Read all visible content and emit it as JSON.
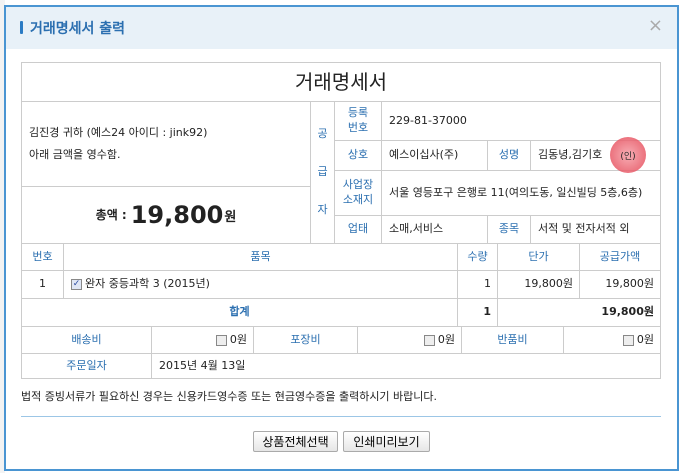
{
  "dialog": {
    "title": "거래명세서 출력",
    "close": "×"
  },
  "doc": {
    "title": "거래명세서",
    "customer": "김진경 귀하 (예스24 아이디 : jink92)",
    "receipt_note": "아래 금액을 영수함.",
    "total_label": "총액 : ",
    "total_value": "19,800",
    "total_unit": "원",
    "supplier_label": [
      "공",
      "급",
      "자"
    ],
    "reg_label": "등록\n번호",
    "reg_value": "229-81-37000",
    "company_label": "상호",
    "company_value": "예스이십사(주)",
    "name_label": "성명",
    "name_value": "김동녕,김기호",
    "seal": "(인)",
    "addr_label": "사업장\n소재지",
    "addr_value": "서울 영등포구 은행로 11(여의도동, 일신빌딩 5층,6층)",
    "biz_label": "업태",
    "biz_value": "소매,서비스",
    "item_label": "종목",
    "item_value": "서적 및 전자서적 외"
  },
  "items": {
    "headers": [
      "번호",
      "품목",
      "수량",
      "단가",
      "공급가액"
    ],
    "rows": [
      {
        "no": "1",
        "name": "완자 중등과학 3 (2015년)",
        "qty": "1",
        "price": "19,800원",
        "amount": "19,800원",
        "checked": true
      }
    ],
    "sum_label": "합계",
    "sum_qty": "1",
    "sum_amount": "19,800원"
  },
  "fees": [
    {
      "label": "배송비",
      "value": "0원"
    },
    {
      "label": "포장비",
      "value": "0원"
    },
    {
      "label": "반품비",
      "value": "0원"
    }
  ],
  "order": {
    "label": "주문일자",
    "value": "2015년 4월 13일"
  },
  "notice": "법적 증빙서류가 필요하신 경우는 신용카드영수증 또는 현금영수증을 출력하시기 바랍니다.",
  "buttons": {
    "select_all": "상품전체선택",
    "print_preview": "인쇄미리보기"
  }
}
